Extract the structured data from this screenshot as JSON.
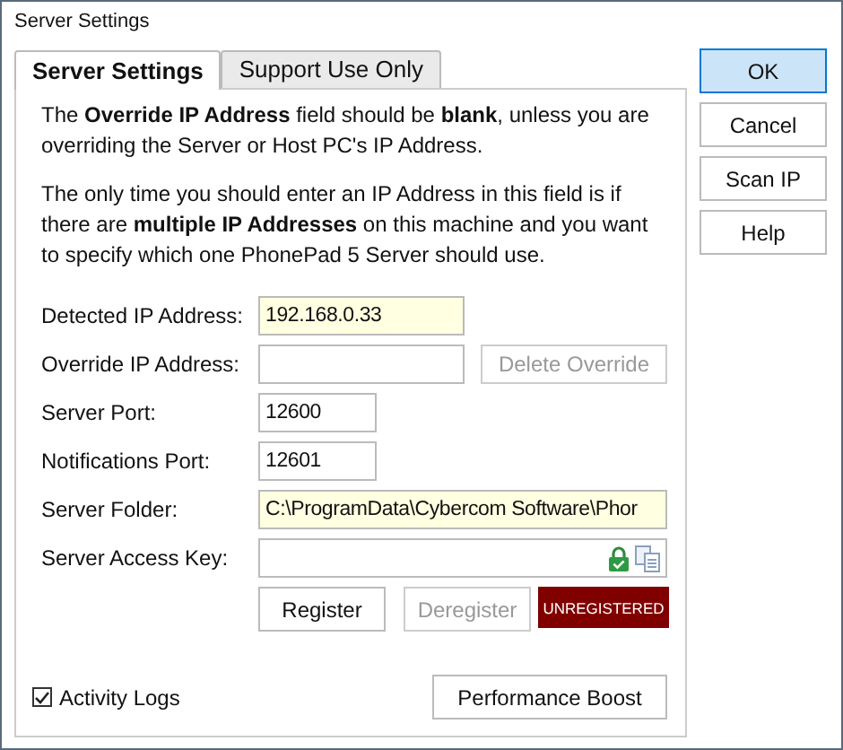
{
  "window": {
    "title": "Server Settings"
  },
  "tabs": [
    {
      "label": "Server Settings",
      "selected": true
    },
    {
      "label": "Support Use Only",
      "selected": false
    }
  ],
  "intro": [
    "The **Override IP Address** field should be **blank**, unless you are overriding the Server or Host PC's IP Address.",
    "The only time you should enter an IP Address in this field is if there are **multiple IP Addresses** on this machine and you want to specify which one PhonePad 5 Server should use."
  ],
  "fields": [
    {
      "kind": "address",
      "label": "Detected IP Address:",
      "value": "192.168.0.33",
      "readonly": true
    },
    {
      "kind": "address",
      "label": "Override IP Address:",
      "readonly": false,
      "button": {
        "label": "Delete Override",
        "disabled": true
      }
    },
    {
      "kind": "port",
      "label": "Server Port:",
      "value": "12600",
      "readonly": false
    },
    {
      "kind": "port",
      "label": "Notifications Port:",
      "value": "12601",
      "readonly": false
    },
    {
      "kind": "path",
      "label": "Server Folder:",
      "value": "C:\\ProgramData\\Cybercom Software\\Phor",
      "readonly": true
    },
    {
      "kind": "key",
      "label": "Server Access Key:",
      "readonly": false,
      "icons": true
    }
  ],
  "registration": {
    "buttons": [
      {
        "label": "Register",
        "disabled": false
      },
      {
        "label": "Deregister",
        "disabled": true
      }
    ],
    "status": "UNREGISTERED"
  },
  "activity_logs": {
    "label": "Activity Logs",
    "checked": true
  },
  "performance_button": "Performance Boost",
  "side_buttons": [
    {
      "label": "OK",
      "default": true
    },
    {
      "label": "Cancel",
      "default": false
    },
    {
      "label": "Scan IP",
      "default": false
    },
    {
      "label": "Help",
      "default": false
    }
  ]
}
